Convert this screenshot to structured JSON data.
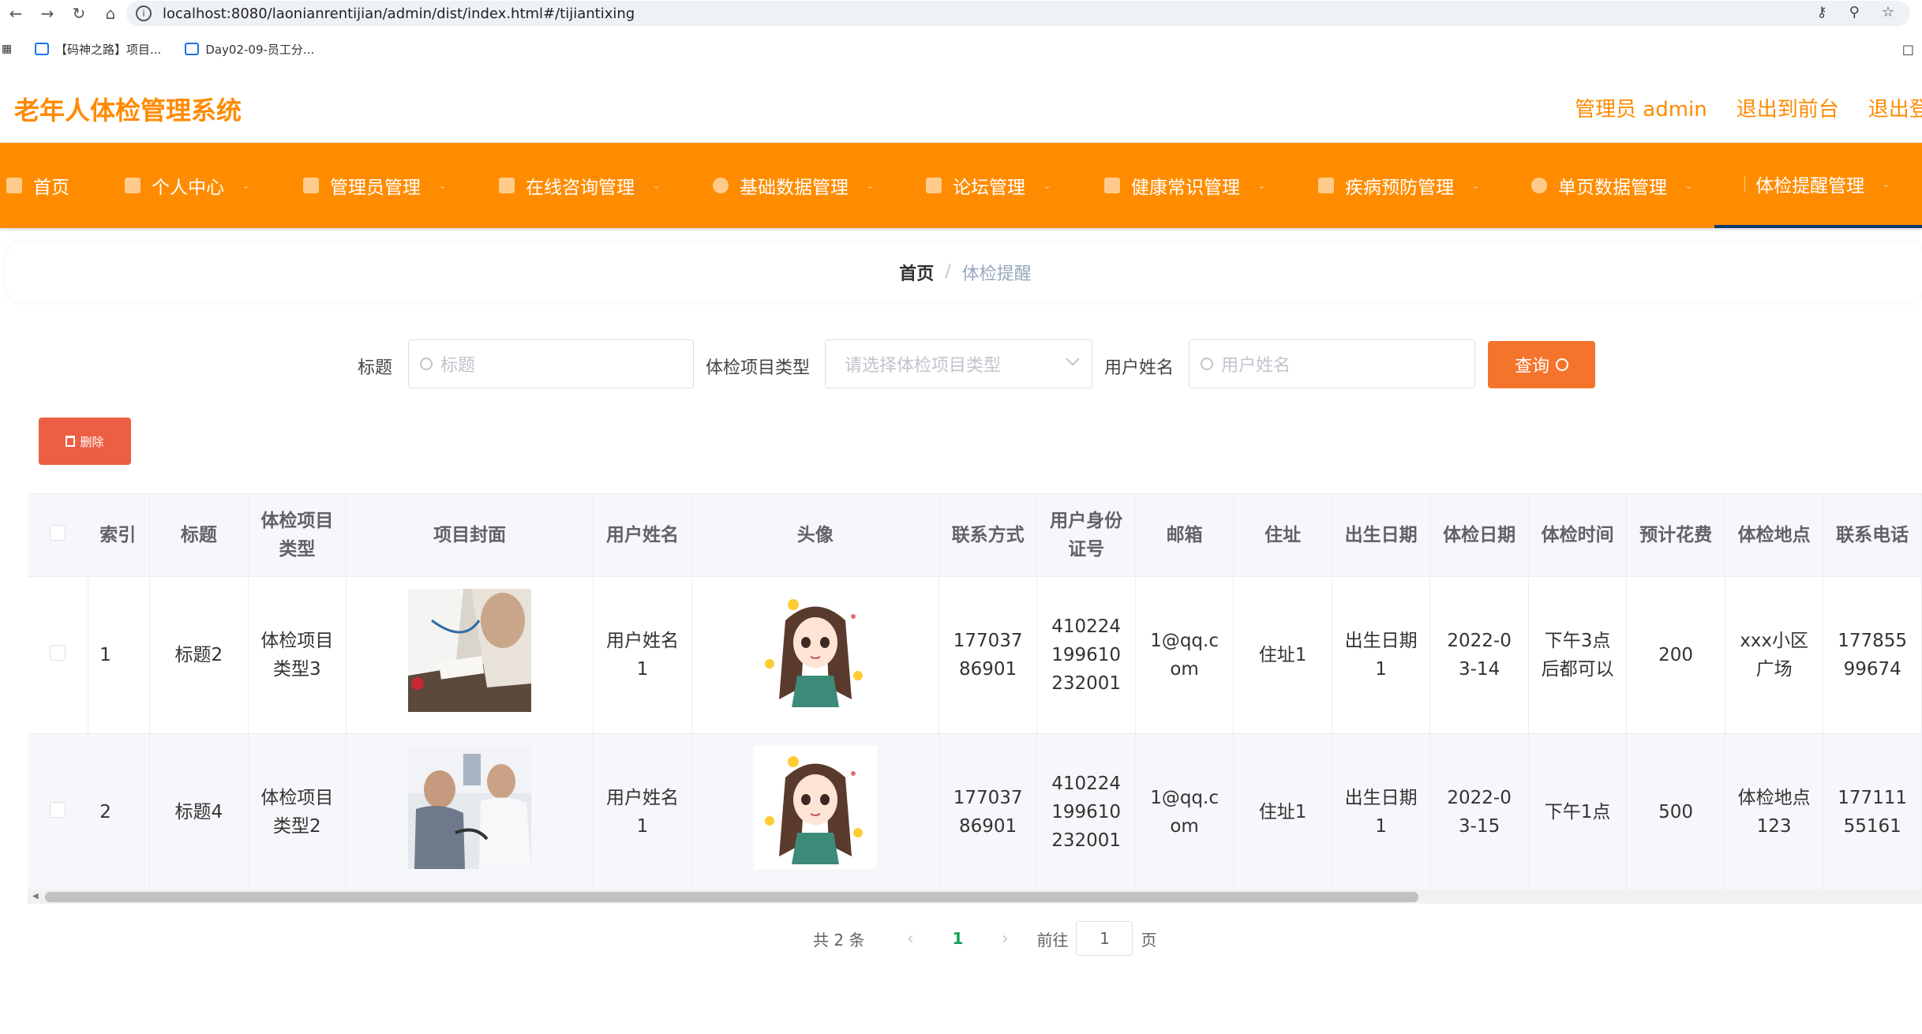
{
  "browser": {
    "url": "localhost:8080/laonianrentijian/admin/dist/index.html#/tijiantixing",
    "bookmarks": [
      "【码神之路】项目...",
      "Day02-09-员工分..."
    ]
  },
  "header": {
    "title": "老年人体检管理系统",
    "admin_label": "管理员 admin",
    "front_link": "退出到前台",
    "logout_link": "退出登录"
  },
  "menu": {
    "items": [
      {
        "label": "首页"
      },
      {
        "label": "个人中心"
      },
      {
        "label": "管理员管理"
      },
      {
        "label": "在线咨询管理"
      },
      {
        "label": "基础数据管理"
      },
      {
        "label": "论坛管理"
      },
      {
        "label": "健康常识管理"
      },
      {
        "label": "疾病预防管理"
      },
      {
        "label": "单页数据管理"
      },
      {
        "label": "体检提醒管理"
      }
    ],
    "active_color": "#0b3a6f",
    "bg_color": "#ff8c00"
  },
  "breadcrumb": {
    "home": "首页",
    "separator": "/",
    "current": "体检提醒"
  },
  "search": {
    "title_label": "标题",
    "title_placeholder": "标题",
    "type_label": "体检项目类型",
    "type_placeholder": "请选择体检项目类型",
    "user_label": "用户姓名",
    "user_placeholder": "用户姓名",
    "query_button": "查询"
  },
  "actions": {
    "delete_button": "删除"
  },
  "table": {
    "headers": [
      "索引",
      "标题",
      "体检项目类型",
      "项目封面",
      "用户姓名",
      "头像",
      "联系方式",
      "用户身份证号",
      "邮箱",
      "住址",
      "出生日期",
      "体检日期",
      "体检时间",
      "预计花费",
      "体检地点",
      "联系电话"
    ],
    "rows": [
      {
        "index": "1",
        "title": "标题2",
        "type": "体检项目类型3",
        "user": "用户姓名1",
        "phone": "17703786901",
        "id_card": "410224199610232001",
        "email": "1@qq.com",
        "address": "住址1",
        "birth": "出生日期1",
        "date": "2022-03-14",
        "time": "下午3点后都可以",
        "cost": "200",
        "location": "xxx小区广场",
        "tel": "17785599674"
      },
      {
        "index": "2",
        "title": "标题4",
        "type": "体检项目类型2",
        "user": "用户姓名1",
        "phone": "17703786901",
        "id_card": "410224199610232001",
        "email": "1@qq.com",
        "address": "住址1",
        "birth": "出生日期1",
        "date": "2022-03-15",
        "time": "下午1点",
        "cost": "500",
        "location": "体检地点123",
        "tel": "17711155161"
      }
    ]
  },
  "pagination": {
    "total": "共 2 条",
    "current_page": "1",
    "goto_label": "前往",
    "goto_value": "1",
    "page_suffix": "页"
  }
}
